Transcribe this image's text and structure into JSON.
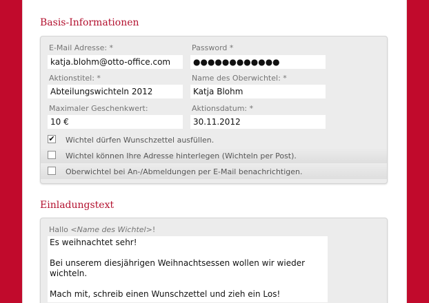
{
  "basis": {
    "title": "Basis-Informationen",
    "fields": {
      "email": {
        "label": "E-Mail Adresse: *",
        "value": "katja.blohm@otto-office.com"
      },
      "password": {
        "label": "Password *",
        "value": "●●●●●●●●●●●●"
      },
      "action_title": {
        "label": "Aktionstitel: *",
        "value": "Abteilungswichteln 2012"
      },
      "organizer_name": {
        "label": "Name des Oberwichtel: *",
        "value": "Katja Blohm"
      },
      "max_gift_value": {
        "label": "Maximaler Geschenkwert:",
        "value": "10 €"
      },
      "action_date": {
        "label": "Aktionsdatum: *",
        "value": "30.11.2012"
      }
    },
    "checkboxes": [
      {
        "label": "Wichtel dürfen Wunschzettel ausfüllen.",
        "checked": true,
        "mark": "✔"
      },
      {
        "label": "Wichtel können Ihre Adresse hinterlegen (Wichteln per Post).",
        "checked": false,
        "mark": ""
      },
      {
        "label": "Oberwichtel bei An-/Abmeldungen per E-Mail benachrichtigen.",
        "checked": false,
        "mark": ""
      }
    ]
  },
  "invitation": {
    "title": "Einladungstext",
    "greeting_prefix": "Hallo ",
    "greeting_placeholder": "<Name des Wichtel>",
    "greeting_suffix": "!",
    "text": "Es weihnachtet sehr!\n\nBei unserem diesjährigen Weihnachtsessen wollen wir wieder wichteln.\n\nMach mit, schreib einen Wunschzettel und zieh ein Los!"
  }
}
